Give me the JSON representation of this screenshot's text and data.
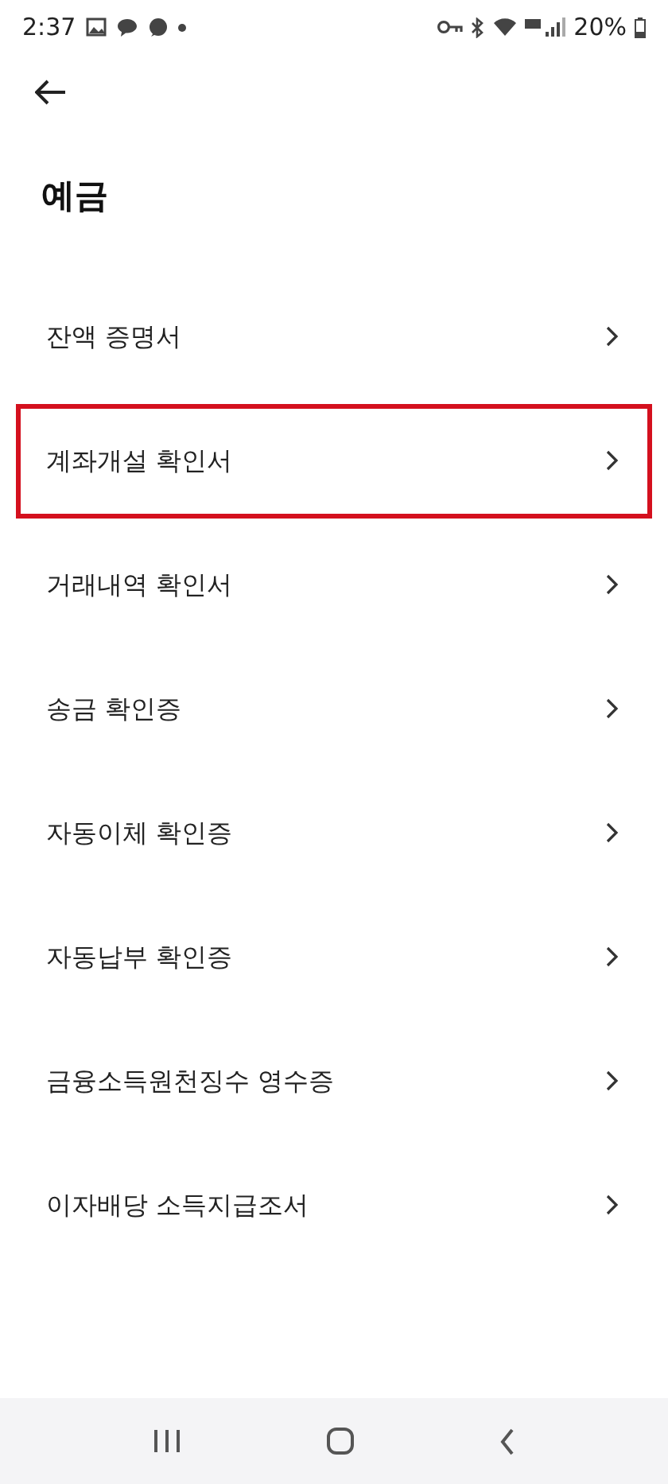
{
  "status_bar": {
    "time": "2:37",
    "battery": "20%"
  },
  "title": "예금",
  "items": [
    {
      "label": "잔액 증명서",
      "highlighted": false
    },
    {
      "label": "계좌개설 확인서",
      "highlighted": true
    },
    {
      "label": "거래내역 확인서",
      "highlighted": false
    },
    {
      "label": "송금 확인증",
      "highlighted": false
    },
    {
      "label": "자동이체 확인증",
      "highlighted": false
    },
    {
      "label": "자동납부 확인증",
      "highlighted": false
    },
    {
      "label": "금융소득원천징수 영수증",
      "highlighted": false
    },
    {
      "label": "이자배당 소득지급조서",
      "highlighted": false
    }
  ]
}
